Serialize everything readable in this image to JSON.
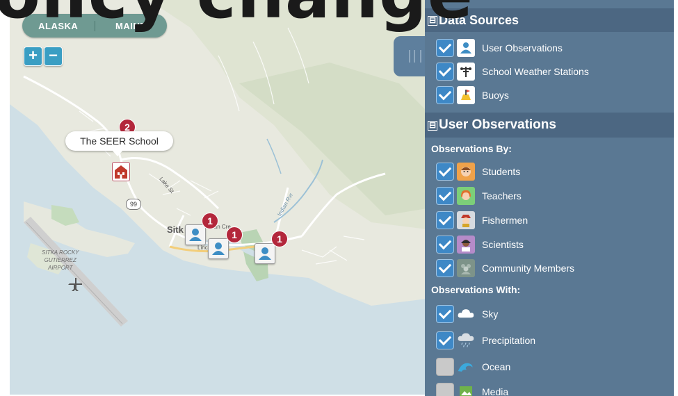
{
  "overlay_title": "olicy change",
  "map": {
    "region_tabs": [
      "ALASKA",
      "MAINE"
    ],
    "zoom_in": "+",
    "zoom_out": "−",
    "callout": "The SEER School",
    "town_label": "Sitk",
    "highway_label": "99",
    "street_labels": [
      "Lake St",
      "Lincol",
      "Indian Rvr",
      "ian Cre"
    ],
    "airport_label_lines": [
      "SITKA ROCKY",
      "GUTIERREZ",
      "AIRPORT"
    ],
    "cluster_badges": [
      "2",
      "1",
      "1",
      "1"
    ],
    "colors": {
      "water": "#cfdfe6",
      "land": "#e8e9e0",
      "road": "#ffffff",
      "badge": "#b3273b"
    }
  },
  "panel": {
    "data_sources": {
      "title": "Data Sources",
      "toggle": "⊟",
      "items": [
        {
          "label": "User Observations",
          "checked": true,
          "icon": "person-icon"
        },
        {
          "label": "School Weather Stations",
          "checked": true,
          "icon": "weather-station-icon"
        },
        {
          "label": "Buoys",
          "checked": true,
          "icon": "buoy-icon"
        }
      ]
    },
    "user_observations": {
      "title": "User Observations",
      "toggle": "⊟",
      "by_label": "Observations By:",
      "by_items": [
        {
          "label": "Students",
          "checked": true,
          "icon": "student-icon"
        },
        {
          "label": "Teachers",
          "checked": true,
          "icon": "teacher-icon"
        },
        {
          "label": "Fishermen",
          "checked": true,
          "icon": "fisherman-icon"
        },
        {
          "label": "Scientists",
          "checked": true,
          "icon": "scientist-icon"
        },
        {
          "label": "Community Members",
          "checked": true,
          "icon": "community-icon"
        }
      ],
      "with_label": "Observations With:",
      "with_items": [
        {
          "label": "Sky",
          "checked": true,
          "icon": "cloud-icon"
        },
        {
          "label": "Precipitation",
          "checked": true,
          "icon": "rain-cloud-icon"
        },
        {
          "label": "Ocean",
          "checked": false,
          "icon": "wave-icon"
        },
        {
          "label": "Media",
          "checked": false,
          "icon": "image-icon"
        }
      ]
    },
    "colors": {
      "panel": "#5a7893",
      "header": "#4c6782",
      "check": "#3e88c6"
    }
  }
}
